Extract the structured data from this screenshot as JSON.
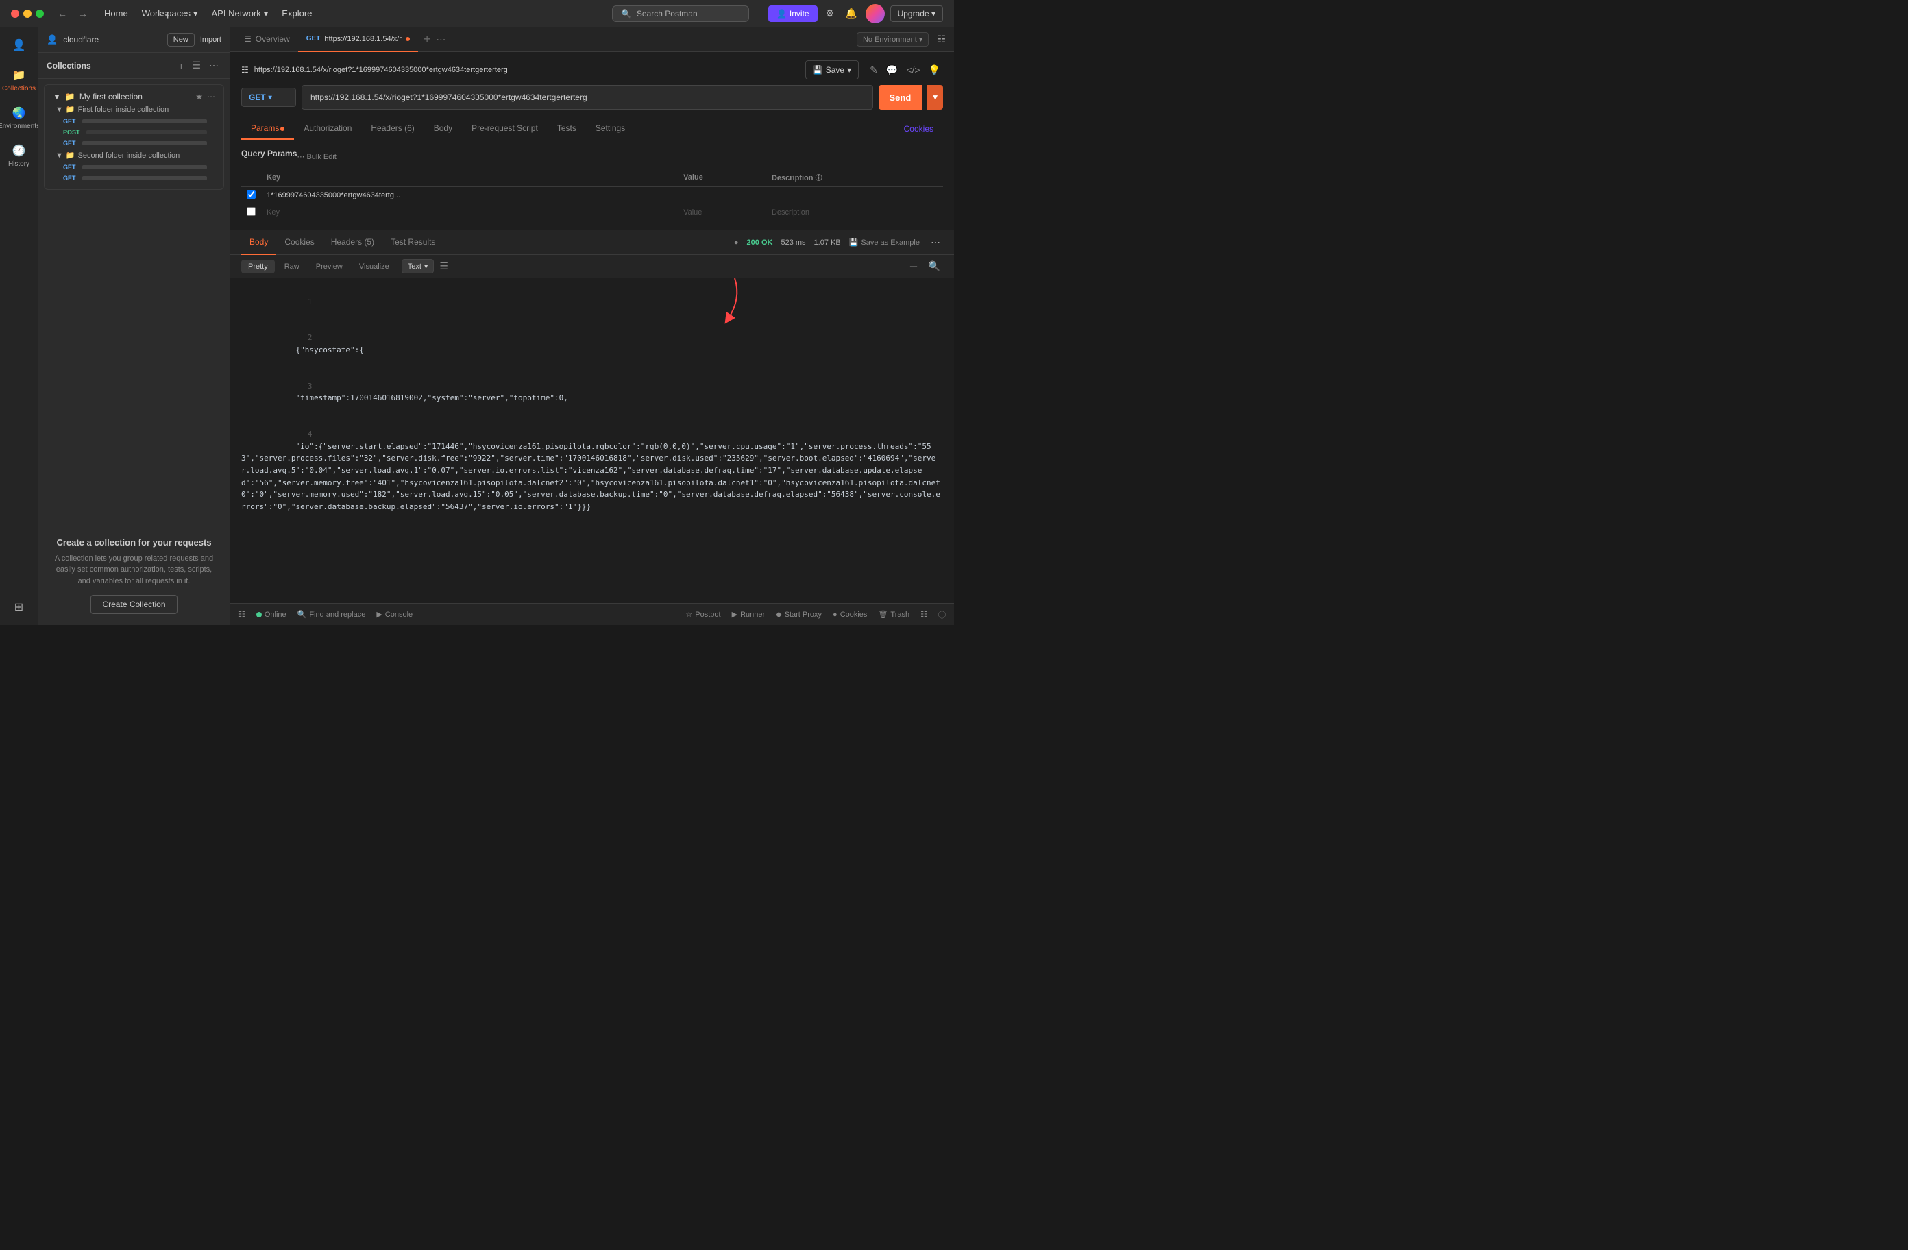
{
  "titlebar": {
    "nav": {
      "home": "Home",
      "workspaces": "Workspaces",
      "api_network": "API Network",
      "explore": "Explore"
    },
    "search_placeholder": "Search Postman",
    "invite": "Invite",
    "upgrade": "Upgrade"
  },
  "user": {
    "name": "cloudflare",
    "new_label": "New",
    "import_label": "Import"
  },
  "sidebar": {
    "collections_label": "Collections",
    "environments_label": "Environments",
    "history_label": "History"
  },
  "collection": {
    "name": "My first collection",
    "folders": [
      {
        "name": "First folder inside collection",
        "requests": [
          {
            "method": "GET",
            "url": ""
          },
          {
            "method": "POST",
            "url": ""
          },
          {
            "method": "GET",
            "url": ""
          }
        ]
      },
      {
        "name": "Second folder inside collection",
        "requests": [
          {
            "method": "GET",
            "url": ""
          },
          {
            "method": "GET",
            "url": ""
          }
        ]
      }
    ]
  },
  "create_collection": {
    "title": "Create a collection for your requests",
    "description": "A collection lets you group related requests and easily set common authorization, tests, scripts, and variables for all requests in it.",
    "button": "Create Collection"
  },
  "tabs": {
    "overview": "Overview",
    "active_tab": {
      "method": "GET",
      "url": "https://192.168.1.54/x/r"
    }
  },
  "request": {
    "url_full": "https://192.168.1.54/x/rioget?1*1699974604335000*ertgw4634tertgerterterg",
    "url_display": "https://192.168.1.54/x/rioget?1*1699974604335000*ertgw4634tertgerterterg",
    "method": "GET",
    "save_label": "Save",
    "send_label": "Send"
  },
  "request_tabs": [
    {
      "label": "Params",
      "active": true,
      "dot": true
    },
    {
      "label": "Authorization",
      "active": false
    },
    {
      "label": "Headers (6)",
      "active": false
    },
    {
      "label": "Body",
      "active": false
    },
    {
      "label": "Pre-request Script",
      "active": false
    },
    {
      "label": "Tests",
      "active": false
    },
    {
      "label": "Settings",
      "active": false
    }
  ],
  "cookies_link": "Cookies",
  "params": {
    "section_title": "Query Params",
    "columns": [
      "Key",
      "Value",
      "Description"
    ],
    "bulk_edit": "Bulk Edit",
    "rows": [
      {
        "checked": true,
        "key": "1*1699974604335000*ertgw4634tertg...",
        "value": "",
        "description": ""
      },
      {
        "checked": false,
        "key": "Key",
        "value": "Value",
        "description": "Description"
      }
    ]
  },
  "response": {
    "tabs": [
      "Body",
      "Cookies",
      "Headers (5)",
      "Test Results"
    ],
    "active_tab": "Body",
    "status": "200 OK",
    "time": "523 ms",
    "size": "1.07 KB",
    "save_example": "Save as Example",
    "format_tabs": [
      "Pretty",
      "Raw",
      "Preview",
      "Visualize"
    ],
    "active_format": "Pretty",
    "format_type": "Text",
    "lines": [
      {
        "num": "1",
        "content": ""
      },
      {
        "num": "2",
        "content": "{\"hsycostate\":{"
      },
      {
        "num": "3",
        "content": "\"timestamp\":1700146016819002,\"system\":\"server\",\"topotime\":0,"
      },
      {
        "num": "4",
        "content": "\"io\":{\"server.start.elapsed\":\"171446\",\"hsycovicenza161.pisopilota.rgbcolor\":\"rgb(0,0,0)\",\"server.cpu.usage\":\"1\",\"server.process.threads\":\"553\",\"server.process.files\":\"32\",\"server.disk.free\":\"9922\",\"server.time\":\"1700146016818\",\"server.disk.used\":\"235629\",\"server.boot.elapsed\":\"4160694\",\"server.load.avg.5\":\"0.04\",\"server.load.avg.1\":\"0.07\",\"server.io.errors.list\":\"vicenza162\",\"server.database.defrag.time\":\"17\",\"server.database.update.elapsed\":\"56\",\"server.memory.free\":\"401\",\"hsycovicenza161.pisopilota.dalcnet2\":\"0\",\"hsycovicenza161.pisopilota.dalcnet1\":\"0\",\"hsycovicenza161.pisopilota.dalcnet0\":\"0\",\"server.memory.used\":\"182\",\"server.load.avg.15\":\"0.05\",\"server.database.backup.time\":\"0\",\"server.database.defrag.elapsed\":\"56438\",\"server.console.errors\":\"0\",\"server.database.backup.elapsed\":\"56437\",\"server.io.errors\":\"1\"}}}"
      }
    ]
  },
  "status_bar": {
    "online": "Online",
    "find_replace": "Find and replace",
    "console": "Console",
    "postbot": "Postbot",
    "runner": "Runner",
    "start_proxy": "Start Proxy",
    "cookies": "Cookies",
    "trash": "Trash"
  },
  "no_environment": "No Environment"
}
